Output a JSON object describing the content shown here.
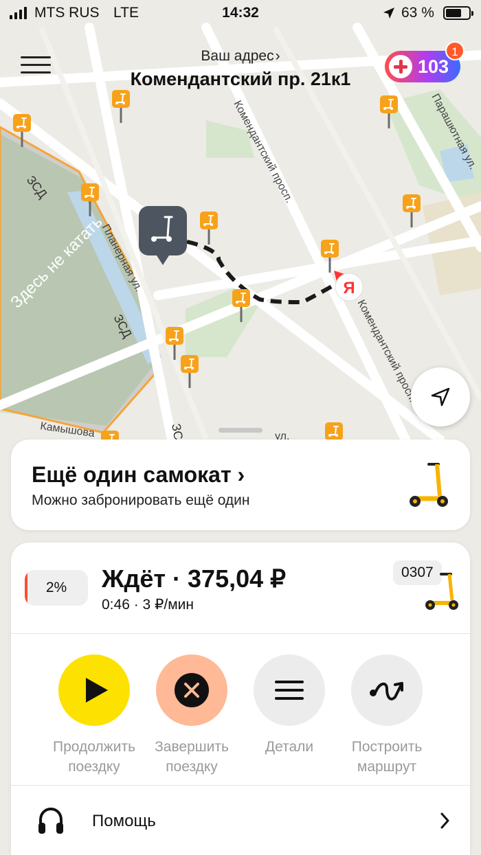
{
  "status_bar": {
    "carrier": "MTS RUS",
    "network": "LTE",
    "time": "14:32",
    "battery": "63 %"
  },
  "header": {
    "address_label": "Ваш адрес",
    "address": "Комендантский пр. 21к1",
    "plus_points": "103",
    "notification_count": "1"
  },
  "map": {
    "street_labels": [
      "Комендантский просп.",
      "Комендантский просп.",
      "Планерная ул.",
      "ЗСД",
      "ЗСД",
      "ЗСД",
      "Парашютная ул.",
      "Камышова",
      "ул."
    ],
    "zone_label": "Здесь не катать",
    "brand_pin": "Я"
  },
  "another_scooter": {
    "title": "Ещё один самокат",
    "subtitle": "Можно забронировать ещё один"
  },
  "ride": {
    "battery_pct": "2%",
    "battery_level": 0.02,
    "status": "Ждёт · 375,04 ₽",
    "meta": "0:46 · 3 ₽/мин",
    "scooter_number": "0307",
    "actions": [
      {
        "label_1": "Продолжить",
        "label_2": "поездку",
        "icon": "play-icon"
      },
      {
        "label_1": "Завершить",
        "label_2": "поездку",
        "icon": "close-circle-icon"
      },
      {
        "label_1": "Детали",
        "label_2": "",
        "icon": "menu-lines-icon"
      },
      {
        "label_1": "Построить",
        "label_2": "маршрут",
        "icon": "route-icon"
      }
    ],
    "help": "Помощь"
  },
  "colors": {
    "accent_yellow": "#fde100",
    "finish_peach": "#ffb996",
    "scooter_orange": "#f7a21b",
    "route_dash": "#1a1a1a"
  }
}
